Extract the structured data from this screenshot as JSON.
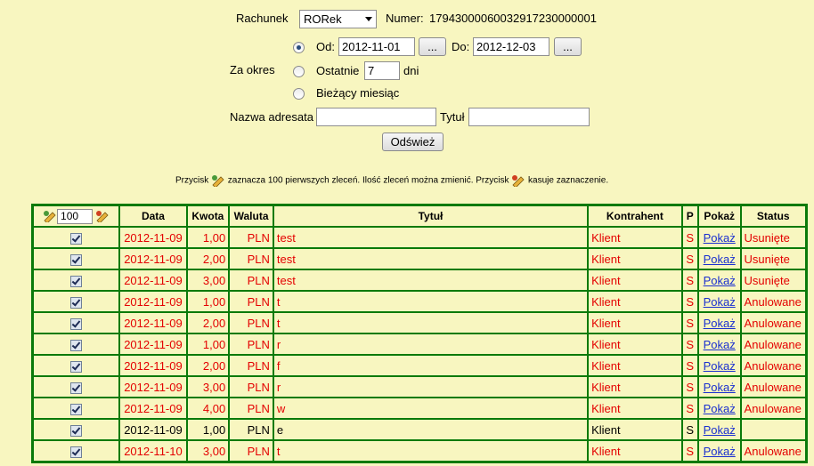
{
  "account": {
    "label": "Rachunek",
    "selected": "RORek",
    "number_label": "Numer:",
    "number": "17943000060032917230000001"
  },
  "period": {
    "label": "Za okres",
    "from_label": "Od:",
    "from_value": "2012-11-01",
    "to_label": "Do:",
    "to_value": "2012-12-03",
    "picker_label": "...",
    "last_label": "Ostatnie",
    "last_value": "7",
    "days_label": "dni",
    "current_month_label": "Bieżący miesiąc"
  },
  "filters": {
    "recipient_label": "Nazwa adresata",
    "recipient_value": "",
    "title_label": "Tytuł",
    "title_value": "",
    "refresh_label": "Odśwież"
  },
  "hint": {
    "part1": "Przycisk",
    "part2": "zaznacza 100 pierwszych zleceń. Ilość zleceń można zmienić. Przycisk",
    "part3": "kasuje zaznaczenie."
  },
  "table": {
    "select_count": "100",
    "headers": {
      "date": "Data",
      "amount": "Kwota",
      "currency": "Waluta",
      "title": "Tytuł",
      "counterparty": "Kontrahent",
      "p": "P",
      "show": "Pokaż",
      "status": "Status"
    },
    "rows": [
      {
        "checked": true,
        "date": "2012-11-09",
        "amount": "1,00",
        "currency": "PLN",
        "title": "test",
        "counterparty": "Klient",
        "p": "S",
        "show": "Pokaż",
        "status": "Usunięte",
        "red": true
      },
      {
        "checked": true,
        "date": "2012-11-09",
        "amount": "2,00",
        "currency": "PLN",
        "title": "test",
        "counterparty": "Klient",
        "p": "S",
        "show": "Pokaż",
        "status": "Usunięte",
        "red": true
      },
      {
        "checked": true,
        "date": "2012-11-09",
        "amount": "3,00",
        "currency": "PLN",
        "title": "test",
        "counterparty": "Klient",
        "p": "S",
        "show": "Pokaż",
        "status": "Usunięte",
        "red": true
      },
      {
        "checked": true,
        "date": "2012-11-09",
        "amount": "1,00",
        "currency": "PLN",
        "title": "t",
        "counterparty": "Klient",
        "p": "S",
        "show": "Pokaż",
        "status": "Anulowane",
        "red": true
      },
      {
        "checked": true,
        "date": "2012-11-09",
        "amount": "2,00",
        "currency": "PLN",
        "title": "t",
        "counterparty": "Klient",
        "p": "S",
        "show": "Pokaż",
        "status": "Anulowane",
        "red": true
      },
      {
        "checked": true,
        "date": "2012-11-09",
        "amount": "1,00",
        "currency": "PLN",
        "title": "r",
        "counterparty": "Klient",
        "p": "S",
        "show": "Pokaż",
        "status": "Anulowane",
        "red": true
      },
      {
        "checked": true,
        "date": "2012-11-09",
        "amount": "2,00",
        "currency": "PLN",
        "title": "f",
        "counterparty": "Klient",
        "p": "S",
        "show": "Pokaż",
        "status": "Anulowane",
        "red": true
      },
      {
        "checked": true,
        "date": "2012-11-09",
        "amount": "3,00",
        "currency": "PLN",
        "title": "r",
        "counterparty": "Klient",
        "p": "S",
        "show": "Pokaż",
        "status": "Anulowane",
        "red": true
      },
      {
        "checked": true,
        "date": "2012-11-09",
        "amount": "4,00",
        "currency": "PLN",
        "title": "w",
        "counterparty": "Klient",
        "p": "S",
        "show": "Pokaż",
        "status": "Anulowane",
        "red": true
      },
      {
        "checked": true,
        "date": "2012-11-09",
        "amount": "1,00",
        "currency": "PLN",
        "title": "e",
        "counterparty": "Klient",
        "p": "S",
        "show": "Pokaż",
        "status": "",
        "red": false
      },
      {
        "checked": true,
        "date": "2012-11-10",
        "amount": "3,00",
        "currency": "PLN",
        "title": "t",
        "counterparty": "Klient",
        "p": "S",
        "show": "Pokaż",
        "status": "Anulowane",
        "red": true
      }
    ]
  }
}
